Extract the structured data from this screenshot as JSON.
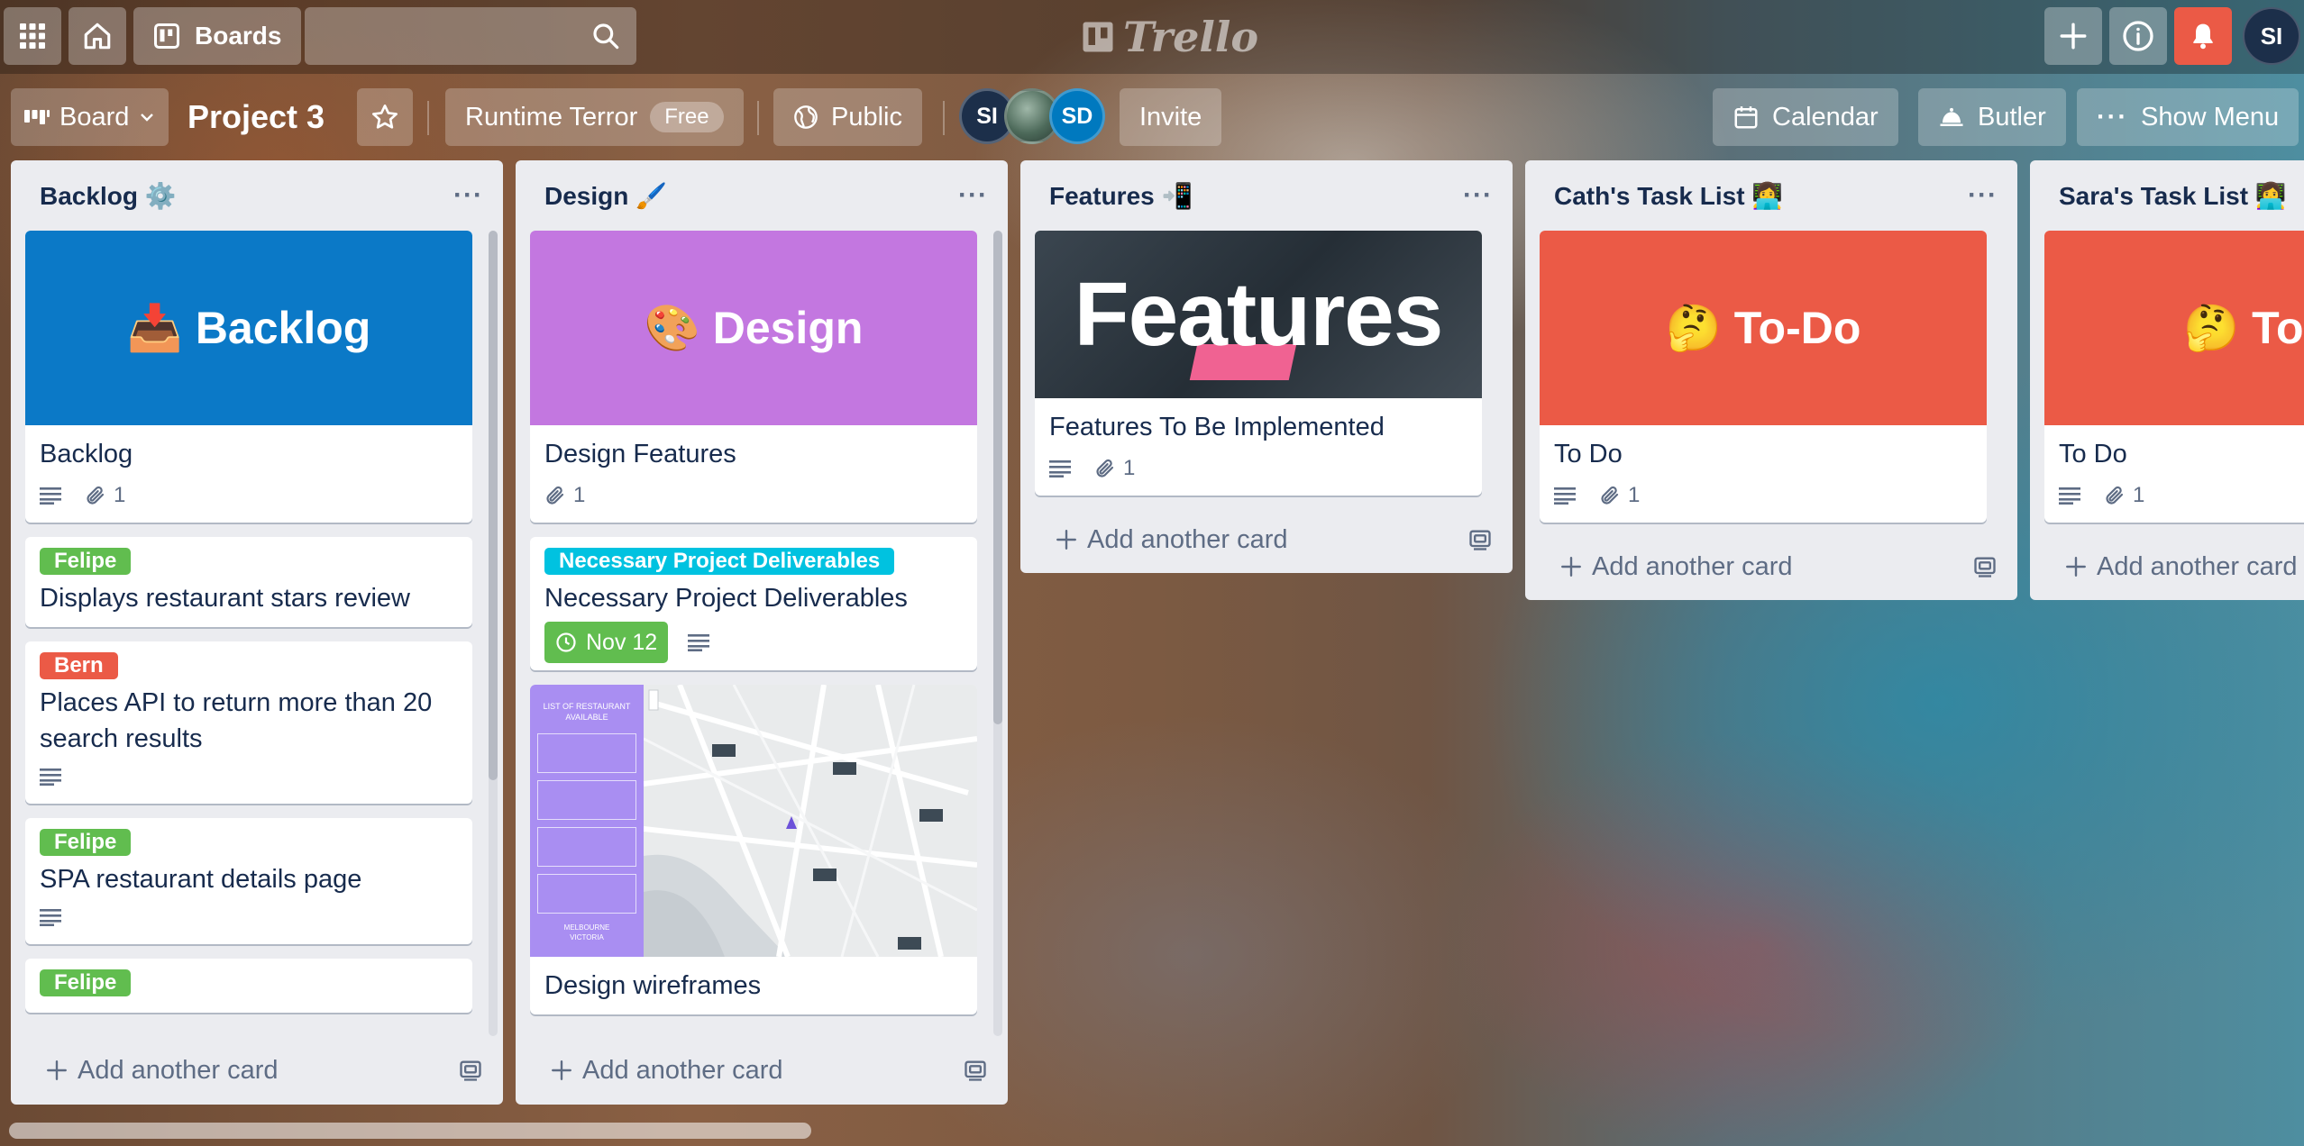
{
  "header": {
    "boards_label": "Boards",
    "search_placeholder": "",
    "logo_text": "Trello",
    "user_initials": "SI"
  },
  "board": {
    "view_label": "Board",
    "title": "Project 3",
    "team_name": "Runtime Terror",
    "team_plan": "Free",
    "visibility": "Public",
    "members": [
      "SI",
      "SD"
    ],
    "invite_label": "Invite",
    "calendar_label": "Calendar",
    "butler_label": "Butler",
    "show_menu_label": "Show Menu"
  },
  "lists": [
    {
      "title": "Backlog ⚙️",
      "add_card": "Add another card",
      "cards": [
        {
          "cover_text": "📥 Backlog",
          "cover_color": "#0b79c7",
          "title": "Backlog",
          "attachments": "1"
        },
        {
          "label": "Felipe",
          "label_color": "#61bd4f",
          "title": "Displays restaurant stars review"
        },
        {
          "label": "Bern",
          "label_color": "#eb5a46",
          "title": "Places API to return more than 20 search results"
        },
        {
          "label": "Felipe",
          "label_color": "#61bd4f",
          "title": "SPA restaurant details page"
        },
        {
          "label": "Felipe",
          "label_color": "#61bd4f"
        }
      ]
    },
    {
      "title": "Design 🖌️",
      "add_card": "Add another card",
      "cards": [
        {
          "cover_text": "🎨 Design",
          "cover_color": "#c377e0",
          "title": "Design Features",
          "attachments": "1"
        },
        {
          "label": "Necessary Project Deliverables",
          "label_color": "#00c2e0",
          "title": "Necessary Project Deliverables",
          "due": "Nov 12"
        },
        {
          "title": "Design wireframes"
        }
      ]
    },
    {
      "title": "Features 📲",
      "add_card": "Add another card",
      "cards": [
        {
          "cover_text": "Features",
          "title": "Features To Be Implemented",
          "attachments": "1"
        }
      ]
    },
    {
      "title": "Cath's Task List 👩‍💻",
      "add_card": "Add another card",
      "cards": [
        {
          "cover_text": "🤔 To-Do",
          "cover_color": "#eb5a46",
          "title": "To Do",
          "attachments": "1"
        }
      ]
    },
    {
      "title": "Sara's Task List 👩‍💻",
      "add_card": "Add another card",
      "cards": [
        {
          "cover_text": "🤔 To-D",
          "cover_color": "#eb5a46",
          "title": "To Do",
          "attachments": "1"
        }
      ]
    }
  ],
  "wireframe": {
    "panel_title": "LIST OF RESTAURANT AVAILABLE",
    "footer": "MELBOURNE VICTORIA"
  }
}
